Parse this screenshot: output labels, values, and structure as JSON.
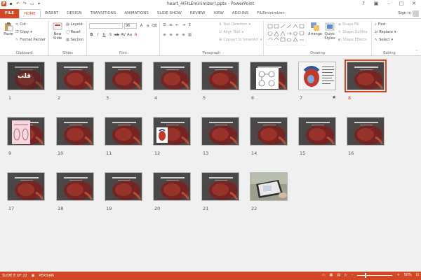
{
  "window": {
    "title": "heart_4(FILEminimizer).pptx - PowerPoint",
    "sign_in": "Sign in"
  },
  "tabs": [
    {
      "label": "FILE",
      "id": "file"
    },
    {
      "label": "HOME",
      "id": "home",
      "active": true
    },
    {
      "label": "INSERT",
      "id": "insert"
    },
    {
      "label": "DESIGN",
      "id": "design"
    },
    {
      "label": "TRANSITIONS",
      "id": "transitions"
    },
    {
      "label": "ANIMATIONS",
      "id": "animations"
    },
    {
      "label": "SLIDE SHOW",
      "id": "slideshow"
    },
    {
      "label": "REVIEW",
      "id": "review"
    },
    {
      "label": "VIEW",
      "id": "view"
    },
    {
      "label": "ADD-INS",
      "id": "addins"
    },
    {
      "label": "FILEminimizer",
      "id": "fileminimizer"
    }
  ],
  "ribbon": {
    "clipboard": {
      "paste": "Paste",
      "cut": "Cut",
      "copy": "Copy",
      "format_painter": "Format Painter",
      "label": "Clipboard"
    },
    "slides": {
      "new_slide": "New Slide",
      "layout": "Layout",
      "reset": "Reset",
      "section": "Section",
      "label": "Slides"
    },
    "font": {
      "size": "96",
      "label": "Font"
    },
    "paragraph": {
      "text_direction": "Text Direction",
      "align_text": "Align Text",
      "convert_smartart": "Convert to SmartArt",
      "label": "Paragraph"
    },
    "drawing": {
      "arrange": "Arrange",
      "quick_styles": "Quick Styles",
      "shape_fill": "Shape Fill",
      "shape_outline": "Shape Outline",
      "shape_effects": "Shape Effects",
      "label": "Drawing"
    },
    "editing": {
      "find": "Find",
      "replace": "Replace",
      "select": "Select",
      "label": "Editing"
    }
  },
  "slides": [
    {
      "num": "1",
      "kind": "title",
      "title_text": "قلب"
    },
    {
      "num": "2",
      "kind": "heart"
    },
    {
      "num": "3",
      "kind": "heart"
    },
    {
      "num": "4",
      "kind": "heart"
    },
    {
      "num": "5",
      "kind": "heart"
    },
    {
      "num": "6",
      "kind": "diagram"
    },
    {
      "num": "7",
      "kind": "anatomy",
      "animated": true
    },
    {
      "num": "8",
      "kind": "heart",
      "selected": true
    },
    {
      "num": "9",
      "kind": "pink"
    },
    {
      "num": "10",
      "kind": "heart"
    },
    {
      "num": "11",
      "kind": "heart"
    },
    {
      "num": "12",
      "kind": "heart-img"
    },
    {
      "num": "13",
      "kind": "heart"
    },
    {
      "num": "14",
      "kind": "heart"
    },
    {
      "num": "15",
      "kind": "heart"
    },
    {
      "num": "16",
      "kind": "heart"
    },
    {
      "num": "17",
      "kind": "heart"
    },
    {
      "num": "18",
      "kind": "heart"
    },
    {
      "num": "19",
      "kind": "heart"
    },
    {
      "num": "20",
      "kind": "heart"
    },
    {
      "num": "21",
      "kind": "heart"
    },
    {
      "num": "22",
      "kind": "photo"
    }
  ],
  "status": {
    "slide_info": "SLIDE 8 OF 22",
    "language": "PERSIAN",
    "zoom": "50%",
    "zoom_value": 50
  },
  "colors": {
    "accent": "#d24726",
    "slide_bg": "#4a4a4a"
  }
}
